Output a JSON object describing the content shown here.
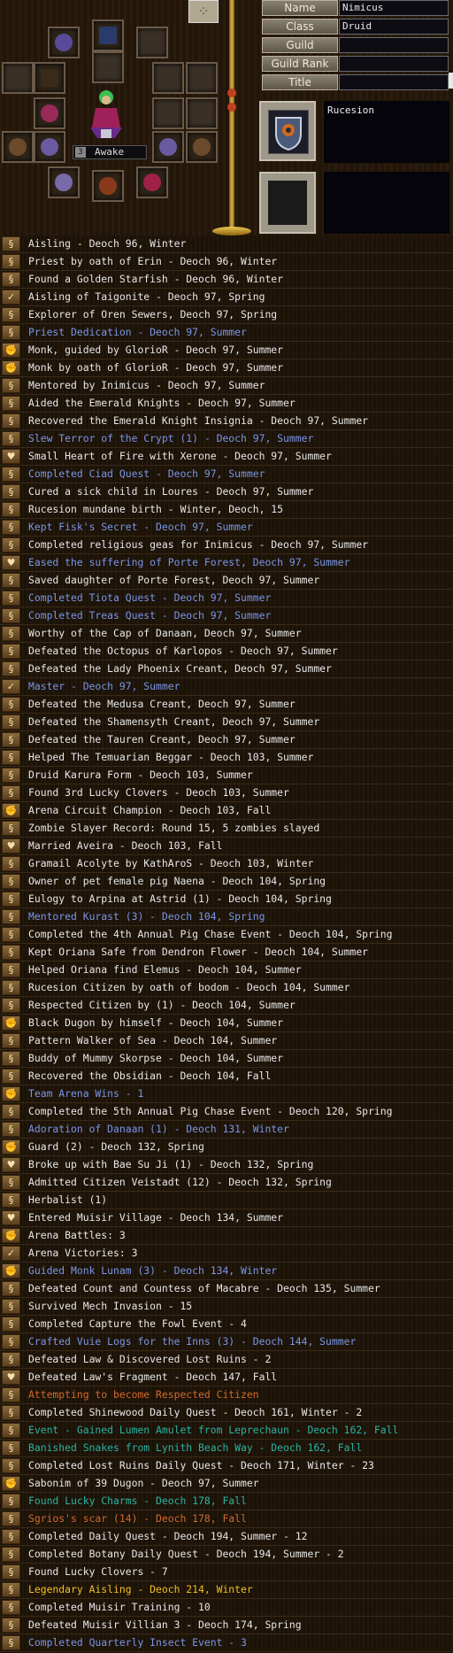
{
  "colors": {
    "white": "#e8e8e8",
    "blue": "#7a96e8",
    "orange": "#d26a2c",
    "teal": "#28b4a4",
    "yellow": "#f0c020"
  },
  "profile": {
    "fields": [
      {
        "label": "Name",
        "value": "Nimicus"
      },
      {
        "label": "Class",
        "value": "Druid"
      },
      {
        "label": "Guild",
        "value": ""
      },
      {
        "label": "Guild Rank",
        "value": ""
      },
      {
        "label": "Title",
        "value": ""
      }
    ],
    "nation": "Rucesion",
    "status_number": "3",
    "status": "Awake"
  },
  "legend_icons": {
    "scroll": "scroll-icon",
    "heart": "heart-icon",
    "check": "check-icon",
    "fist": "fist-icon"
  },
  "legends": [
    {
      "text": "Aisling - Deoch 96, Winter",
      "color": "white",
      "icon": "scroll"
    },
    {
      "text": "Priest by oath of Erin - Deoch 96, Winter",
      "color": "white",
      "icon": "scroll"
    },
    {
      "text": "Found a Golden Starfish - Deoch 96, Winter",
      "color": "white",
      "icon": "scroll"
    },
    {
      "text": "Aisling of Taigonite - Deoch 97, Spring",
      "color": "white",
      "icon": "check"
    },
    {
      "text": "Explorer of Oren Sewers, Deoch 97, Spring",
      "color": "white",
      "icon": "scroll"
    },
    {
      "text": "Priest Dedication - Deoch 97, Summer",
      "color": "blue",
      "icon": "scroll"
    },
    {
      "text": "Monk, guided by GlorioR - Deoch 97, Summer",
      "color": "white",
      "icon": "fist"
    },
    {
      "text": "Monk by oath of GlorioR - Deoch 97, Summer",
      "color": "white",
      "icon": "fist"
    },
    {
      "text": "Mentored by Inimicus - Deoch 97, Summer",
      "color": "white",
      "icon": "scroll"
    },
    {
      "text": "Aided the Emerald Knights - Deoch 97, Summer",
      "color": "white",
      "icon": "scroll"
    },
    {
      "text": "Recovered the Emerald Knight Insignia - Deoch 97, Summer",
      "color": "white",
      "icon": "scroll"
    },
    {
      "text": "Slew Terror of the Crypt (1) - Deoch 97, Summer",
      "color": "blue",
      "icon": "scroll"
    },
    {
      "text": "Small Heart of Fire with Xerone - Deoch 97, Summer",
      "color": "white",
      "icon": "heart"
    },
    {
      "text": "Completed Ciad Quest - Deoch 97, Summer",
      "color": "blue",
      "icon": "scroll"
    },
    {
      "text": "Cured a sick child in Loures - Deoch 97, Summer",
      "color": "white",
      "icon": "scroll"
    },
    {
      "text": "Rucesion mundane birth - Winter, Deoch, 15",
      "color": "white",
      "icon": "scroll"
    },
    {
      "text": "Kept Fisk's Secret - Deoch 97, Summer",
      "color": "blue",
      "icon": "scroll"
    },
    {
      "text": "Completed religious geas for Inimicus - Deoch 97, Summer",
      "color": "white",
      "icon": "scroll"
    },
    {
      "text": "Eased the suffering of Porte Forest, Deoch 97, Summer",
      "color": "blue",
      "icon": "heart"
    },
    {
      "text": "Saved daughter of Porte Forest, Deoch 97, Summer",
      "color": "white",
      "icon": "scroll"
    },
    {
      "text": "Completed Tiota Quest - Deoch 97, Summer",
      "color": "blue",
      "icon": "scroll"
    },
    {
      "text": "Completed Treas Quest - Deoch 97, Summer",
      "color": "blue",
      "icon": "scroll"
    },
    {
      "text": "Worthy of the Cap of Danaan, Deoch 97, Summer",
      "color": "white",
      "icon": "scroll"
    },
    {
      "text": "Defeated the Octopus of Karlopos - Deoch 97, Summer",
      "color": "white",
      "icon": "scroll"
    },
    {
      "text": "Defeated the Lady Phoenix Creant, Deoch 97, Summer",
      "color": "white",
      "icon": "scroll"
    },
    {
      "text": "Master - Deoch 97, Summer",
      "color": "blue",
      "icon": "check"
    },
    {
      "text": "Defeated the Medusa Creant, Deoch 97, Summer",
      "color": "white",
      "icon": "scroll"
    },
    {
      "text": "Defeated the Shamensyth Creant, Deoch 97, Summer",
      "color": "white",
      "icon": "scroll"
    },
    {
      "text": "Defeated the Tauren Creant, Deoch 97, Summer",
      "color": "white",
      "icon": "scroll"
    },
    {
      "text": "Helped The Temuarian Beggar - Deoch 103, Summer",
      "color": "white",
      "icon": "scroll"
    },
    {
      "text": "Druid Karura Form - Deoch 103, Summer",
      "color": "white",
      "icon": "scroll"
    },
    {
      "text": "Found 3rd Lucky Clovers - Deoch 103, Summer",
      "color": "white",
      "icon": "scroll"
    },
    {
      "text": "Arena Circuit Champion - Deoch 103, Fall",
      "color": "white",
      "icon": "fist"
    },
    {
      "text": "Zombie Slayer Record: Round 15, 5 zombies slayed",
      "color": "white",
      "icon": "scroll"
    },
    {
      "text": "Married Aveira - Deoch 103, Fall",
      "color": "white",
      "icon": "heart"
    },
    {
      "text": "Gramail Acolyte by KathAroS - Deoch 103, Winter",
      "color": "white",
      "icon": "scroll"
    },
    {
      "text": "Owner of pet female pig Naena - Deoch 104, Spring",
      "color": "white",
      "icon": "scroll"
    },
    {
      "text": "Eulogy to Arpina at Astrid (1) - Deoch 104, Spring",
      "color": "white",
      "icon": "scroll"
    },
    {
      "text": "Mentored Kurast (3) - Deoch 104, Spring",
      "color": "blue",
      "icon": "scroll"
    },
    {
      "text": "Completed the 4th Annual Pig Chase Event - Deoch 104, Spring",
      "color": "white",
      "icon": "scroll"
    },
    {
      "text": "Kept Oriana Safe from Dendron Flower - Deoch 104, Summer",
      "color": "white",
      "icon": "scroll"
    },
    {
      "text": "Helped Oriana find Elemus - Deoch 104, Summer",
      "color": "white",
      "icon": "scroll"
    },
    {
      "text": "Rucesion Citizen by oath of bodom - Deoch 104, Summer",
      "color": "white",
      "icon": "scroll"
    },
    {
      "text": "Respected Citizen by  (1) - Deoch 104, Summer",
      "color": "white",
      "icon": "scroll"
    },
    {
      "text": "Black Dugon by himself - Deoch 104, Summer",
      "color": "white",
      "icon": "fist"
    },
    {
      "text": "Pattern Walker of Sea - Deoch 104, Summer",
      "color": "white",
      "icon": "scroll"
    },
    {
      "text": "Buddy of Mummy Skorpse - Deoch 104, Summer",
      "color": "white",
      "icon": "scroll"
    },
    {
      "text": "Recovered the Obsidian - Deoch 104, Fall",
      "color": "white",
      "icon": "scroll"
    },
    {
      "text": "Team Arena Wins - 1",
      "color": "blue",
      "icon": "fist"
    },
    {
      "text": "Completed the 5th Annual Pig Chase Event - Deoch 120, Spring",
      "color": "white",
      "icon": "scroll"
    },
    {
      "text": "Adoration of Danaan (1) - Deoch 131, Winter",
      "color": "blue",
      "icon": "scroll"
    },
    {
      "text": "Guard (2) - Deoch 132, Spring",
      "color": "white",
      "icon": "fist"
    },
    {
      "text": "Broke up with Bae Su Ji (1) - Deoch 132, Spring",
      "color": "white",
      "icon": "heart"
    },
    {
      "text": "Admitted Citizen Veistadt (12) - Deoch 132, Spring",
      "color": "white",
      "icon": "scroll"
    },
    {
      "text": "Herbalist (1)",
      "color": "white",
      "icon": "scroll"
    },
    {
      "text": "Entered Muisir Village - Deoch 134, Summer",
      "color": "white",
      "icon": "heart"
    },
    {
      "text": "Arena Battles: 3",
      "color": "white",
      "icon": "fist"
    },
    {
      "text": "Arena Victories: 3",
      "color": "white",
      "icon": "check"
    },
    {
      "text": "Guided Monk Lunam (3) - Deoch 134, Winter",
      "color": "blue",
      "icon": "fist"
    },
    {
      "text": "Defeated Count and Countess of Macabre - Deoch 135, Summer",
      "color": "white",
      "icon": "scroll"
    },
    {
      "text": "Survived Mech Invasion - 15",
      "color": "white",
      "icon": "scroll"
    },
    {
      "text": "Completed Capture the Fowl Event - 4",
      "color": "white",
      "icon": "scroll"
    },
    {
      "text": "Crafted Vuie Logs for the Inns (3) - Deoch 144, Summer",
      "color": "blue",
      "icon": "scroll"
    },
    {
      "text": "Defeated Law & Discovered Lost Ruins - 2",
      "color": "white",
      "icon": "scroll"
    },
    {
      "text": "Defeated Law's Fragment - Deoch 147, Fall",
      "color": "white",
      "icon": "heart"
    },
    {
      "text": "Attempting to become Respected Citizen",
      "color": "orange",
      "icon": "scroll"
    },
    {
      "text": "Completed Shinewood Daily Quest - Deoch 161, Winter - 2",
      "color": "white",
      "icon": "scroll"
    },
    {
      "text": "Event - Gained Lumen Amulet from Leprechaun - Deoch 162, Fall",
      "color": "teal",
      "icon": "scroll"
    },
    {
      "text": "Banished Snakes from Lynith Beach Way - Deoch 162, Fall",
      "color": "teal",
      "icon": "scroll"
    },
    {
      "text": "Completed Lost Ruins Daily Quest - Deoch 171, Winter - 23",
      "color": "white",
      "icon": "scroll"
    },
    {
      "text": "Sabonim of 39 Dugon - Deoch 97, Summer",
      "color": "white",
      "icon": "fist"
    },
    {
      "text": "Found Lucky Charms - Deoch 178, Fall",
      "color": "teal",
      "icon": "scroll"
    },
    {
      "text": "Sgrios's scar (14) - Deoch 178, Fall",
      "color": "orange",
      "icon": "scroll"
    },
    {
      "text": "Completed Daily Quest - Deoch 194, Summer - 12",
      "color": "white",
      "icon": "scroll"
    },
    {
      "text": "Completed Botany Daily Quest - Deoch 194, Summer - 2",
      "color": "white",
      "icon": "scroll"
    },
    {
      "text": "Found Lucky Clovers - 7",
      "color": "white",
      "icon": "scroll"
    },
    {
      "text": "Legendary Aisling - Deoch 214, Winter",
      "color": "yellow",
      "icon": "scroll"
    },
    {
      "text": "Completed Muisir Training - 10",
      "color": "white",
      "icon": "scroll"
    },
    {
      "text": "Defeated Muisir Villian 3 - Deoch 174, Spring",
      "color": "white",
      "icon": "scroll"
    },
    {
      "text": "Completed Quarterly Insect Event - 3",
      "color": "blue",
      "icon": "scroll"
    }
  ]
}
